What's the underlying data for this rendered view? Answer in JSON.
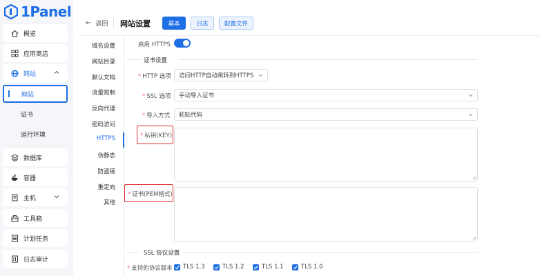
{
  "app": {
    "logo_text": "1Panel"
  },
  "sidebar": {
    "items": [
      {
        "label": "概览",
        "icon": "home-icon"
      },
      {
        "label": "应用商店",
        "icon": "grid-icon"
      },
      {
        "label": "网站",
        "icon": "globe-icon",
        "expanded": true
      },
      {
        "label": "数据库",
        "icon": "database-icon"
      },
      {
        "label": "容器",
        "icon": "docker-icon"
      },
      {
        "label": "主机",
        "icon": "host-icon"
      },
      {
        "label": "工具箱",
        "icon": "toolbox-icon"
      },
      {
        "label": "计划任务",
        "icon": "cron-icon"
      },
      {
        "label": "日志审计",
        "icon": "log-icon"
      }
    ],
    "sub_items": [
      {
        "label": "网站",
        "active": true
      },
      {
        "label": "证书"
      },
      {
        "label": "运行环境"
      }
    ]
  },
  "header": {
    "back_label": "返回",
    "title": "网站设置",
    "tabs": [
      {
        "label": "基本",
        "active": true
      },
      {
        "label": "日志"
      },
      {
        "label": "配置文件"
      }
    ]
  },
  "subnav": {
    "items": [
      "域名设置",
      "网站目录",
      "默认文档",
      "流量限制",
      "反向代理",
      "密码访问",
      "HTTPS",
      "伪静态",
      "防盗链",
      "重定向",
      "其他"
    ],
    "active": "HTTPS"
  },
  "form": {
    "enable_https_label": "启用 HTTPS",
    "enable_https": true,
    "cert_section_title": "证书设置",
    "http_option_label": "HTTP 选项",
    "http_option_value": "访问HTTP自动跳转到HTTPS",
    "ssl_option_label": "SSL 选项",
    "ssl_option_value": "手动导入证书",
    "import_method_label": "导入方式",
    "import_method_value": "粘贴代码",
    "private_key_label": "私钥(KEY)",
    "private_key_value": "",
    "cert_label": "证书(PEM格式)",
    "cert_value": "",
    "ssl_protocol_section_title": "SSL 协议设置",
    "supported_protocols_label": "支持的协议版本",
    "protocols": [
      {
        "label": "TLS 1.3",
        "checked": true
      },
      {
        "label": "TLS 1.2",
        "checked": true
      },
      {
        "label": "TLS 1.1",
        "checked": true
      },
      {
        "label": "TLS 1.0",
        "checked": true
      }
    ]
  },
  "colors": {
    "accent": "#1e6ee6",
    "highlight": "#e0282e",
    "required": "#f56c6c"
  }
}
